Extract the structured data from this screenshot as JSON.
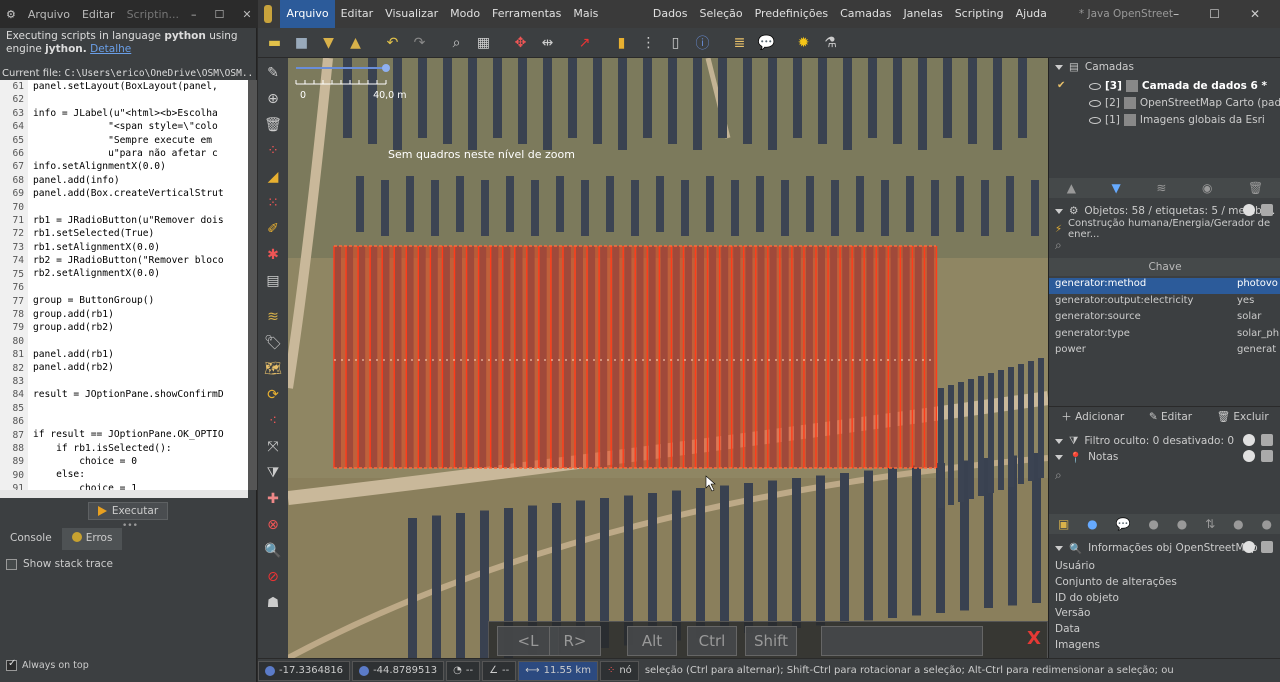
{
  "script_window": {
    "menu": [
      "Arquivo",
      "Editar",
      "Scriptin..."
    ],
    "message_pre": "Executing scripts in language ",
    "language": "python",
    "message_mid": " using engine ",
    "engine": "jython.",
    "details_link": "Detalhe",
    "current_file_label": "Current file:",
    "current_file_path": "C:\\Users\\erico\\OneDrive\\OSM\\OSM...",
    "line_numbers": [
      "61",
      "62",
      "63",
      "64",
      "65",
      "66",
      "67",
      "68",
      "69",
      "70",
      "71",
      "72",
      "73",
      "74",
      "75",
      "76",
      "77",
      "78",
      "79",
      "80",
      "81",
      "82",
      "83",
      "84",
      "85",
      "86",
      "87",
      "88",
      "89",
      "90",
      "91"
    ],
    "code_lines": [
      "panel.setLayout(BoxLayout(panel,",
      "",
      "info = JLabel(u\"<html><b>Escolha",
      "             \"<span style=\\\"colo",
      "             \"Sempre execute em",
      "             u\"para não afetar c",
      "info.setAlignmentX(0.0)",
      "panel.add(info)",
      "panel.add(Box.createVerticalStrut",
      "",
      "rb1 = JRadioButton(u\"Remover dois",
      "rb1.setSelected(True)",
      "rb1.setAlignmentX(0.0)",
      "rb2 = JRadioButton(\"Remover bloco",
      "rb2.setAlignmentX(0.0)",
      "",
      "group = ButtonGroup()",
      "group.add(rb1)",
      "group.add(rb2)",
      "",
      "panel.add(rb1)",
      "panel.add(rb2)",
      "",
      "result = JOptionPane.showConfirmD",
      "",
      "",
      "if result == JOptionPane.OK_OPTIO",
      "    if rb1.isSelected():",
      "        choice = 0",
      "    else:",
      "        choice = 1"
    ],
    "run_button": "Executar",
    "tabs": [
      "Console",
      "Erros"
    ],
    "show_stack_trace": "Show stack trace",
    "always_on_top": "Always on top"
  },
  "main_window": {
    "menu": [
      "Arquivo",
      "Editar",
      "Visualizar",
      "Modo",
      "Ferramentas",
      "Mais ferramentas",
      "Dados",
      "Seleção",
      "Predefinições",
      "Camadas",
      "Janelas",
      "Scripting",
      "Ajuda"
    ],
    "title": "* Java OpenStreetMap Editor (@DressyP...",
    "map": {
      "scale_zero": "0",
      "scale_label": "40,0 m",
      "zoom_message": "Sem quadros neste nível de zoom"
    },
    "keys": [
      "<L",
      "R>",
      "Alt",
      "Ctrl",
      "Shift"
    ],
    "keys_close": "X"
  },
  "layers_panel": {
    "title": "Camadas",
    "layers": [
      {
        "index": "[3]",
        "name": "Camada de dados 6 *"
      },
      {
        "index": "[2]",
        "name": "OpenStreetMap Carto (padr..."
      },
      {
        "index": "[1]",
        "name": "Imagens globais da Esri"
      }
    ]
  },
  "objects_panel": {
    "title": "Objetos: 58 / etiquetas: 5 / membr...",
    "preset": "Construção humana/Energia/Gerador de ener...",
    "column_key": "Chave",
    "tags": [
      {
        "k": "generator:method",
        "v": "photovo"
      },
      {
        "k": "generator:output:electricity",
        "v": "yes"
      },
      {
        "k": "generator:source",
        "v": "solar"
      },
      {
        "k": "generator:type",
        "v": "solar_ph"
      },
      {
        "k": "power",
        "v": "generat"
      }
    ],
    "add": "Adicionar",
    "edit": "Editar",
    "delete": "Excluir"
  },
  "filter_panel": {
    "title": "Filtro oculto: 0 desativado: 0"
  },
  "notes_panel": {
    "title": "Notas"
  },
  "info_panel": {
    "title": "Informações obj OpenStreetMap",
    "rows": [
      "Usuário",
      "Conjunto de alterações",
      "ID do objeto",
      "Versão",
      "Data",
      "Imagens"
    ]
  },
  "status_bar": {
    "lat": "-17.3364816",
    "lon": "-44.8789513",
    "heading": "--",
    "angle": "--",
    "distance": "11.55 km",
    "node": "nó",
    "message": "seleção (Ctrl para alternar); Shift-Ctrl para rotacionar a seleção; Alt-Ctrl para redimensionar a seleção; ou alterar seleção"
  }
}
